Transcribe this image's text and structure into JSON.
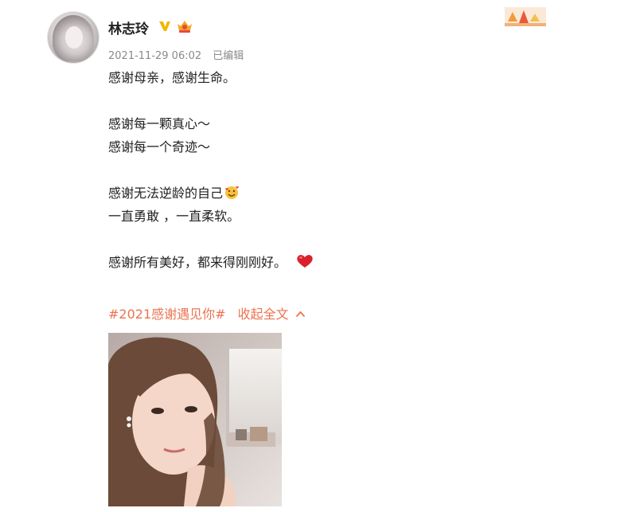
{
  "post": {
    "author_name": "林志玲",
    "timestamp": "2021-11-29 06:02",
    "edited_label": "已编辑",
    "lines": [
      "感谢母亲，感谢生命。",
      "",
      "感谢每一颗真心～",
      "感谢每一个奇迹～",
      "",
      "感谢无法逆龄的自己",
      "一直勇敢 ，一直柔软。",
      "",
      "感谢所有美好，都来得刚刚好。"
    ],
    "hashtag": "#2021感谢遇见你#",
    "collapse_label": "收起全文"
  },
  "icons": {
    "verified": "verified-v-icon",
    "member": "crown-member-icon",
    "smile_emoji": "smiling-hearts-emoji-icon",
    "heart_emoji": "red-heart-emoji-icon",
    "chevron": "chevron-up-icon"
  },
  "colors": {
    "link": "#eb7350",
    "meta": "#8a8a8a",
    "text": "#222222",
    "verified": "#f2b600",
    "heart": "#d9202c"
  }
}
